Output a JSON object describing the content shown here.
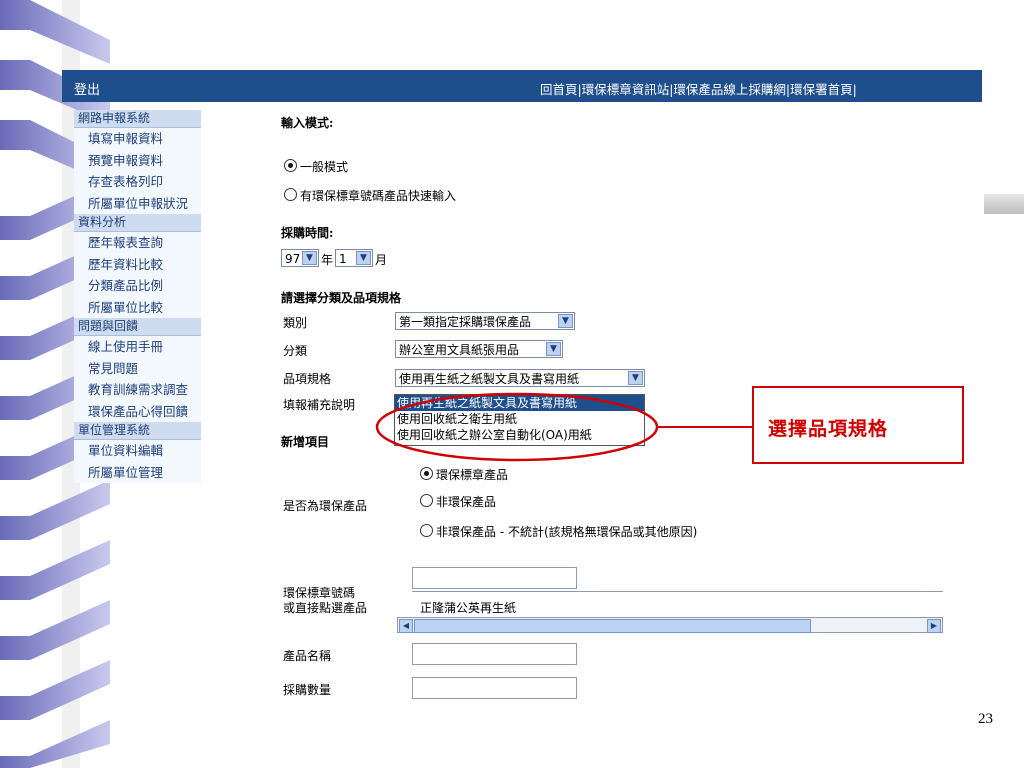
{
  "topbar": {
    "logout_label": "登出",
    "links": "回首頁|環保標章資訊站|環保產品線上採購網|環保署首頁|"
  },
  "sidebar": [
    {
      "type": "section",
      "label": "網路申報系統"
    },
    {
      "type": "item",
      "label": "填寫申報資料"
    },
    {
      "type": "item",
      "label": "預覽申報資料"
    },
    {
      "type": "item",
      "label": "存查表格列印"
    },
    {
      "type": "item",
      "label": "所屬單位申報狀況"
    },
    {
      "type": "section",
      "label": "資料分析"
    },
    {
      "type": "item",
      "label": "歷年報表查詢"
    },
    {
      "type": "item",
      "label": "歷年資料比較"
    },
    {
      "type": "item",
      "label": "分類產品比例"
    },
    {
      "type": "item",
      "label": "所屬單位比較"
    },
    {
      "type": "section",
      "label": "問題與回饋"
    },
    {
      "type": "item",
      "label": "線上使用手冊"
    },
    {
      "type": "item",
      "label": "常見問題"
    },
    {
      "type": "item",
      "label": "教育訓練需求調查"
    },
    {
      "type": "item",
      "label": "環保產品心得回饋"
    },
    {
      "type": "section",
      "label": "單位管理系統"
    },
    {
      "type": "item",
      "label": "單位資料編輯"
    },
    {
      "type": "item",
      "label": "所屬單位管理"
    }
  ],
  "form": {
    "input_mode_label": "輸入模式:",
    "mode_normal": "一般模式",
    "mode_fast": "有環保標章號碼產品快速輸入",
    "purchase_time_label": "採購時間:",
    "year_value": "97",
    "year_unit": "年",
    "month_value": "1",
    "month_unit": "月",
    "category_heading": "請選擇分類及品項規格",
    "class_label": "類別",
    "class_value": "第一類指定採購環保產品",
    "subclass_label": "分類",
    "subclass_value": "辦公室用文具紙張用品",
    "spec_label": "品項規格",
    "spec_value": "使用再生紙之紙製文具及書寫用紙",
    "note_label": "填報補充說明",
    "spec_options": [
      "使用再生紙之紙製文具及書寫用紙",
      "使用回收紙之衛生用紙",
      "使用回收紙之辦公室自動化(OA)用紙"
    ],
    "new_item_label": "新增項目",
    "is_green_label": "是否為環保產品",
    "green_opt1": "環保標章產品",
    "green_opt2": "非環保產品",
    "green_opt3": "非環保產品 - 不統計(該規格無環保品或其他原因)",
    "label_no_line1": "環保標章號碼",
    "label_no_line2": "或直接點選產品",
    "product_pick_value": "正隆蒲公英再生紙",
    "product_name_label": "產品名稱",
    "quantity_label": "採購數量"
  },
  "callout_text": "選擇品項規格",
  "page_number": "23",
  "colors": {
    "topbar": "#1f4e8c",
    "callout": "#d00000",
    "sidebar_section": "#cfdcef"
  }
}
